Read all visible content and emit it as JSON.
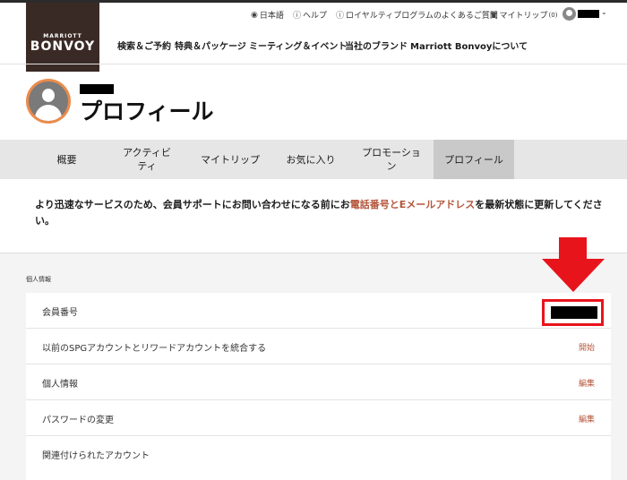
{
  "brand": {
    "line1": "MARRIOTT",
    "line2": "BONVOY"
  },
  "utility": {
    "language": "日本語",
    "help": "ヘルプ",
    "loyalty_faq": "ロイヤルティプログラムのよくあるご質問",
    "my_trips": "マイトリップ",
    "my_trips_count": "(0)"
  },
  "main_nav": [
    "検索＆ご予約",
    "特典＆パッケージ",
    "ミーティング＆イベント",
    "当社のブランド",
    "Marriott Bonvoyについて"
  ],
  "page": {
    "title": "プロフィール"
  },
  "tabs": [
    {
      "label": "概要"
    },
    {
      "label": "アクティビティ"
    },
    {
      "label": "マイトリップ"
    },
    {
      "label": "お気に入り"
    },
    {
      "label": "プロモーション"
    },
    {
      "label": "プロフィール"
    }
  ],
  "notice": {
    "part1": "より迅速なサービスのため、会員サポートにお問い合わせになる前にお",
    "highlight": "電話番号とEメールアドレス",
    "part2": "を最新状態に更新してください。"
  },
  "section": {
    "title": "個人情報",
    "rows": [
      {
        "label": "会員番号",
        "action": ""
      },
      {
        "label": "以前のSPGアカウントとリワードアカウントを統合する",
        "action": "開始"
      },
      {
        "label": "個人情報",
        "action": "編集"
      },
      {
        "label": "パスワードの変更",
        "action": "編集"
      },
      {
        "label": "関連付けられたアカウント",
        "action": ""
      }
    ]
  },
  "icons": {
    "globe": "globe-icon",
    "help": "help-circle-icon",
    "info": "info-circle-icon",
    "trips": "briefcase-icon",
    "chevron": "chevron-down-icon",
    "avatar": "avatar-icon",
    "arrow": "red-down-arrow"
  },
  "colors": {
    "brand_bg": "#3a2a25",
    "accent": "#b4563a",
    "avatar_ring": "#ea8b4c",
    "highlight_red": "#e8141c",
    "tab_bg": "#e6e6e6",
    "tab_active": "#c9c9c9"
  }
}
